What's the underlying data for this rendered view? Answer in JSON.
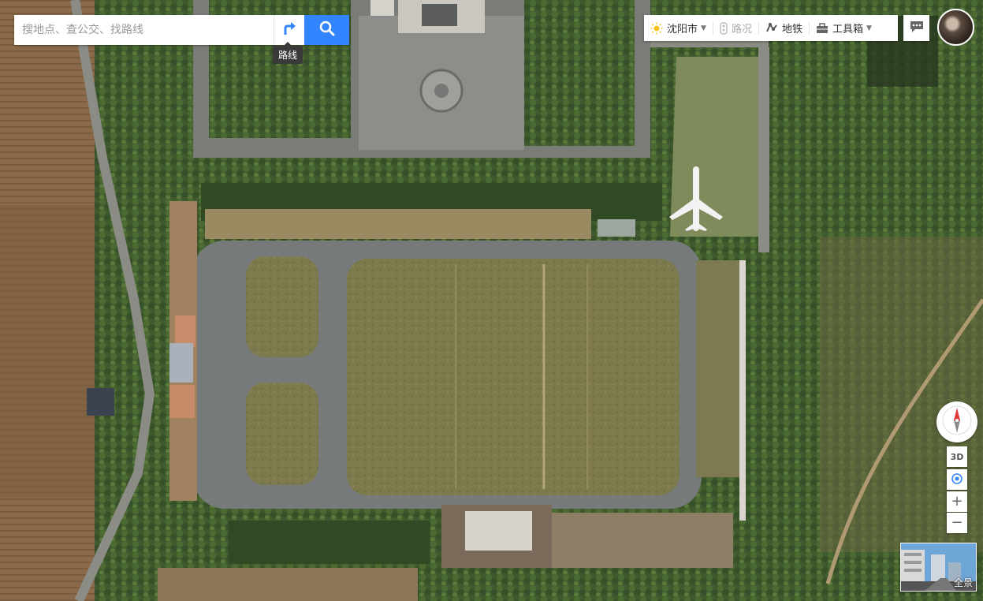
{
  "search": {
    "placeholder": "搜地点、查公交、找路线",
    "route_tooltip": "路线"
  },
  "toolbar": {
    "city": "沈阳市",
    "traffic": "路况",
    "subway": "地铁",
    "toolbox": "工具箱"
  },
  "controls": {
    "three_d": "3D",
    "zoom_in": "+",
    "zoom_out": "−",
    "panorama": "全景"
  },
  "icons": [
    "route-icon",
    "search-icon",
    "weather-sun-icon",
    "traffic-light-icon",
    "subway-icon",
    "toolbox-icon",
    "chevron-down-icon",
    "message-icon",
    "compass-icon",
    "locate-icon"
  ],
  "colors": {
    "accent": "#3385ff",
    "compass_red": "#e4393c"
  }
}
